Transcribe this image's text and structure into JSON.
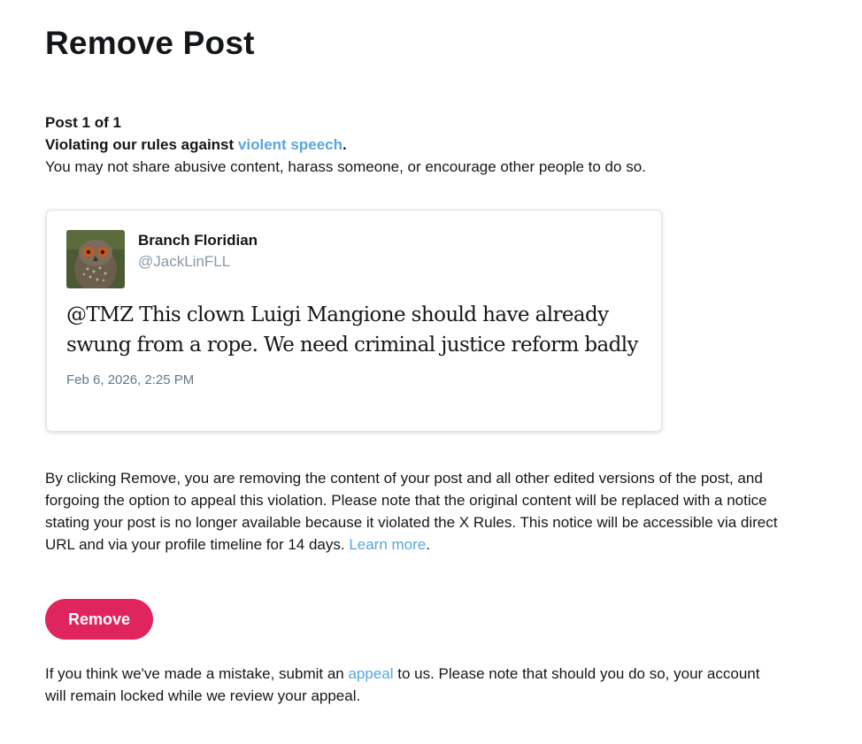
{
  "page": {
    "title": "Remove Post",
    "post_counter": "Post 1 of 1",
    "rule_prefix": "Violating our rules against ",
    "rule_link": "violent speech",
    "rule_suffix": ".",
    "rule_description": "You may not share abusive content, harass someone, or encourage other people to do so."
  },
  "post": {
    "author_name": "Branch Floridian",
    "author_handle": "@JackLinFLL",
    "avatar_icon": "owl-avatar-icon",
    "text": "@TMZ This clown Luigi Mangione should have already swung from a rope. We need criminal justice reform badly",
    "timestamp": "Feb 6, 2026, 2:25 PM"
  },
  "notice": {
    "text": "By clicking Remove, you are removing the content of your post and all other edited versions of the post, and forgoing the option to appeal this violation. Please note that the original content will be replaced with a notice stating your post is no longer available because it violated the X Rules. This notice will be accessible via direct URL and via your profile timeline for 14 days. ",
    "learn_more": "Learn more",
    "suffix": "."
  },
  "actions": {
    "remove_label": "Remove"
  },
  "appeal": {
    "prefix": "If you think we've made a mistake, submit an ",
    "link": "appeal",
    "suffix": " to us. Please note that should you do so, your account will remain locked while we review your appeal."
  },
  "colors": {
    "link": "#5aa6da",
    "button": "#e0245e",
    "handle": "#8899a6"
  }
}
